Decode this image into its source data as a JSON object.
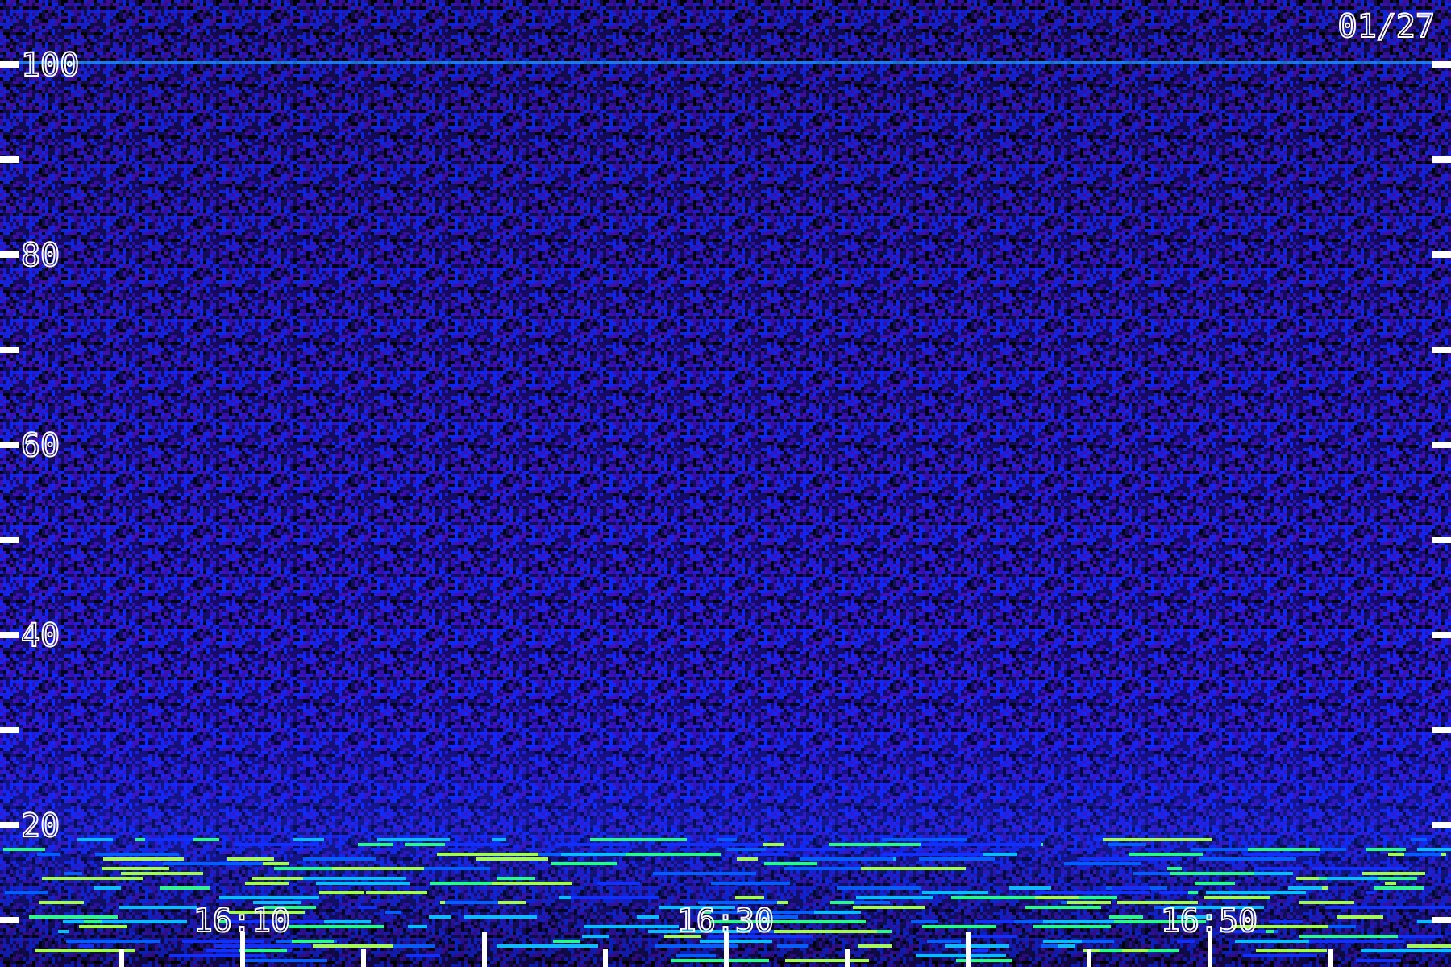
{
  "date": "01/27",
  "y_axis": {
    "labels": [
      "100",
      "80",
      "60",
      "40",
      "20"
    ]
  },
  "x_axis": {
    "labels": [
      "16:10",
      "16:30",
      "16:50"
    ]
  }
}
